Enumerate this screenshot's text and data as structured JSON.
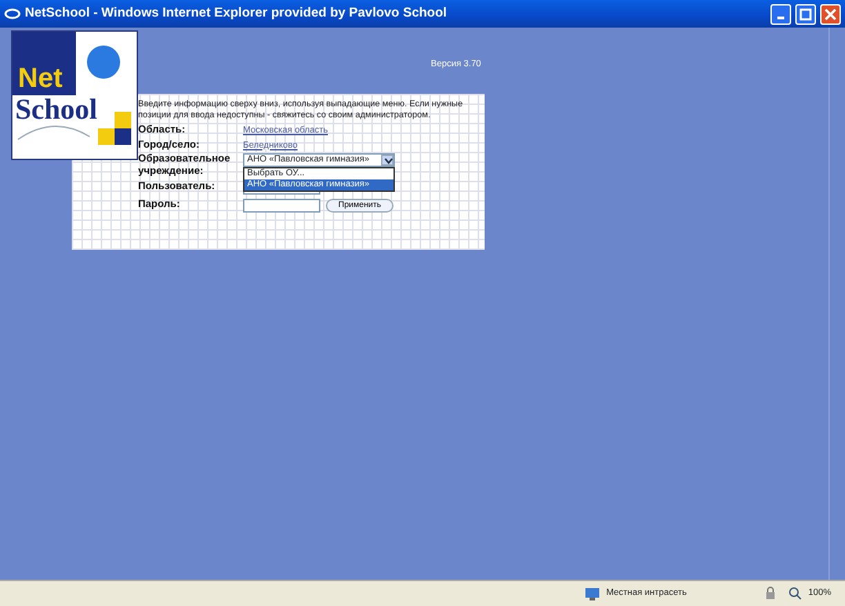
{
  "window": {
    "title": "NetSchool - Windows Internet Explorer provided by Pavlovo School"
  },
  "logo": {
    "top": "Net",
    "bottom": "School"
  },
  "version": "Версия 3.70",
  "form": {
    "instruction": "Введите информацию сверху вниз, используя выпадающие меню. Если нужные позиции для ввода недоступны - свяжитесь со своим администратором.",
    "fields": [
      {
        "kind": "link",
        "label": "Область:",
        "value": "Московская область"
      },
      {
        "kind": "link",
        "label": "Город/село:",
        "value": "Беледниково"
      },
      {
        "kind": "select",
        "label": "Образовательное учреждение:",
        "value": "АНО «Павловская гимназия»",
        "expanded": true,
        "options": [
          {
            "label": "Выбрать ОУ...",
            "selected": false
          },
          {
            "label": "АНО «Павловская гимназия»",
            "selected": true
          }
        ]
      },
      {
        "kind": "input",
        "label": "Пользователь:"
      },
      {
        "kind": "password",
        "label": "Пароль:",
        "button": "Применить"
      }
    ]
  },
  "status_bar": {
    "zone": "Местная интрасеть",
    "zoom": "100%"
  }
}
